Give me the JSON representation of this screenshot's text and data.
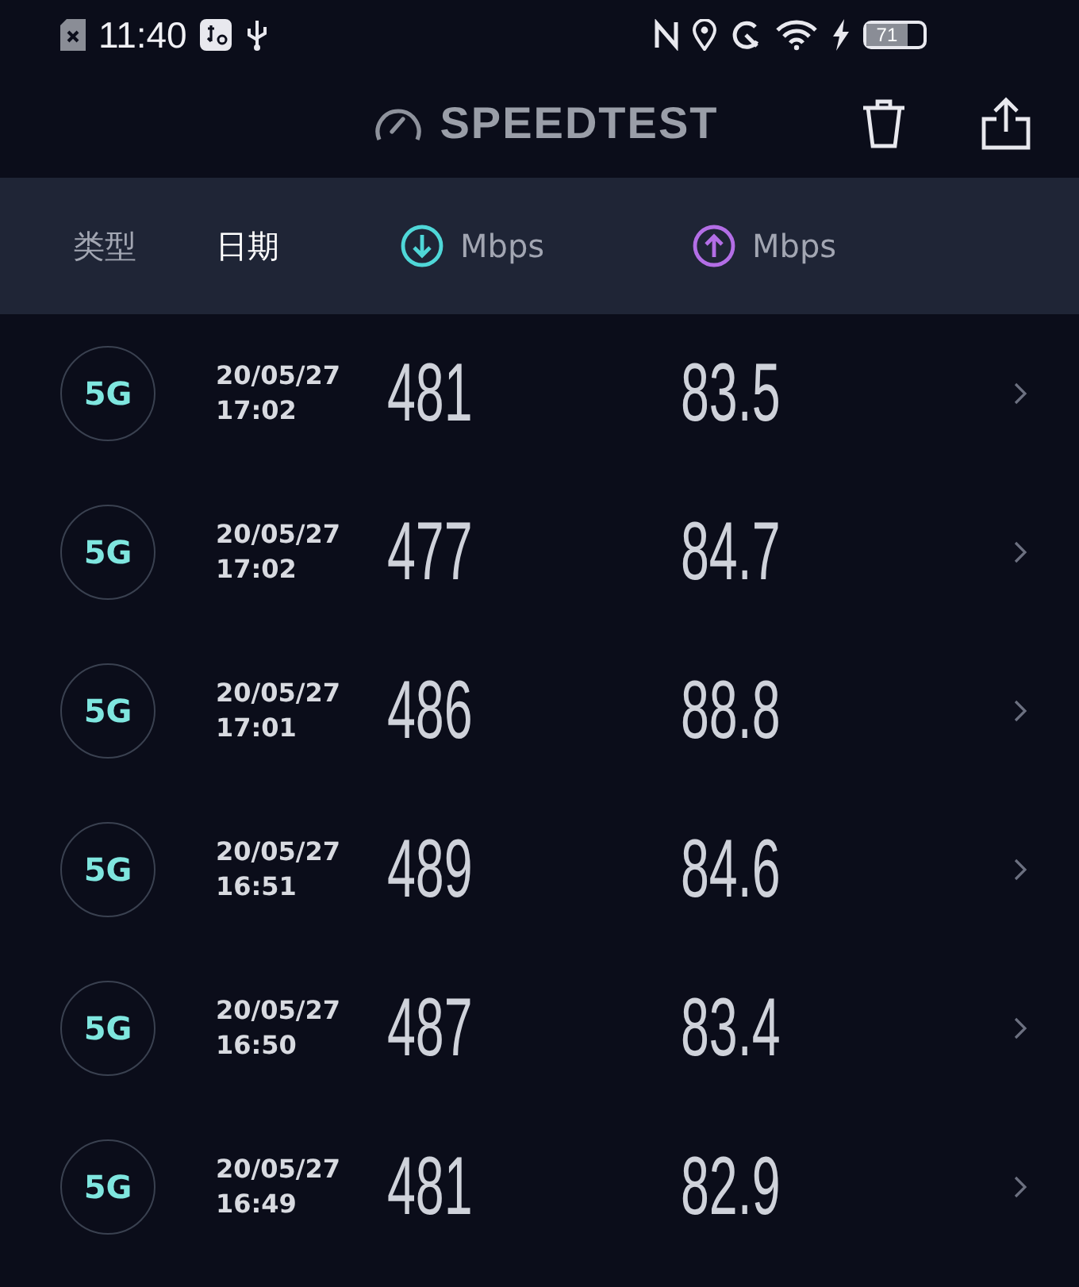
{
  "status_bar": {
    "time": "11:40",
    "battery": "71"
  },
  "title": "SPEEDTEST",
  "columns": [
    {
      "label": "类型",
      "kind": "text",
      "selected": false
    },
    {
      "label": "日期",
      "kind": "text",
      "selected": true
    },
    {
      "label": "Mbps",
      "kind": "download",
      "selected": false
    },
    {
      "label": "Mbps",
      "kind": "upload",
      "selected": false
    }
  ],
  "results": [
    {
      "type": "5G",
      "date": "20/05/27",
      "time": "17:02",
      "download": "481",
      "upload": "83.5"
    },
    {
      "type": "5G",
      "date": "20/05/27",
      "time": "17:02",
      "download": "477",
      "upload": "84.7"
    },
    {
      "type": "5G",
      "date": "20/05/27",
      "time": "17:01",
      "download": "486",
      "upload": "88.8"
    },
    {
      "type": "5G",
      "date": "20/05/27",
      "time": "16:51",
      "download": "489",
      "upload": "84.6"
    },
    {
      "type": "5G",
      "date": "20/05/27",
      "time": "16:50",
      "download": "487",
      "upload": "83.4"
    },
    {
      "type": "5G",
      "date": "20/05/27",
      "time": "16:49",
      "download": "481",
      "upload": "82.9"
    }
  ]
}
